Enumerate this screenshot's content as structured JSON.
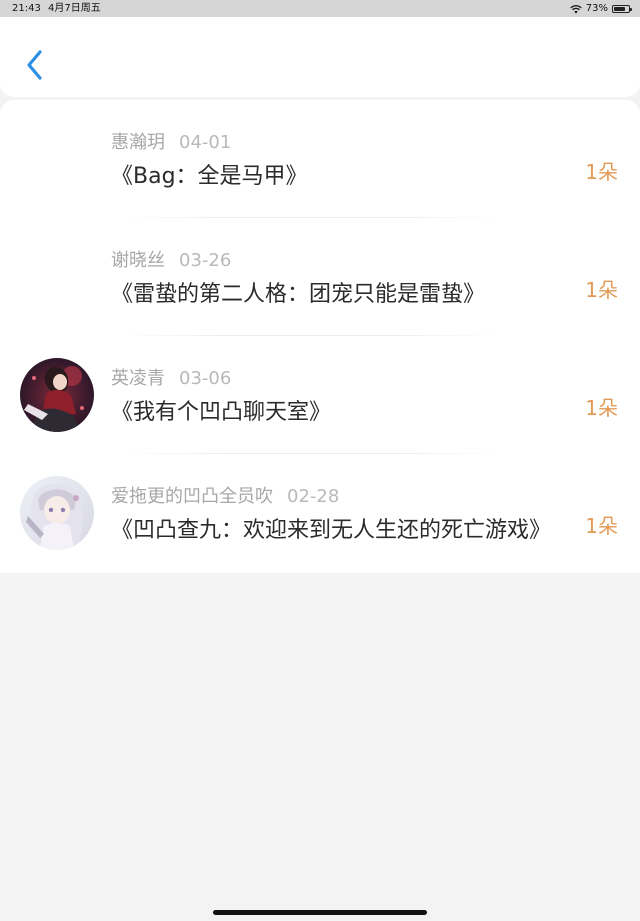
{
  "status_bar": {
    "time": "21:43",
    "date": "4月7日周五",
    "battery": "73%"
  },
  "header": {
    "back_icon": "chevron-left-icon",
    "accent_color": "#2b8fe6"
  },
  "records": [
    {
      "name": "惠瀚玥",
      "date": "04-01",
      "title": "《Bag：全是马甲》",
      "count": "1朵",
      "has_avatar": false
    },
    {
      "name": "谢晓丝",
      "date": "03-26",
      "title": "《雷蛰的第二人格：团宠只能是雷蛰》",
      "count": "1朵",
      "has_avatar": false
    },
    {
      "name": "英凌青",
      "date": "03-06",
      "title": "《我有个凹凸聊天室》",
      "count": "1朵",
      "has_avatar": true
    },
    {
      "name": "爱拖更的凹凸全员吹",
      "date": "02-28",
      "title": "《凹凸查九：欢迎来到无人生还的死亡游戏》",
      "count": "1朵",
      "has_avatar": true
    }
  ],
  "colors": {
    "count_color": "#e39a56",
    "background": "#f4f3f3"
  }
}
